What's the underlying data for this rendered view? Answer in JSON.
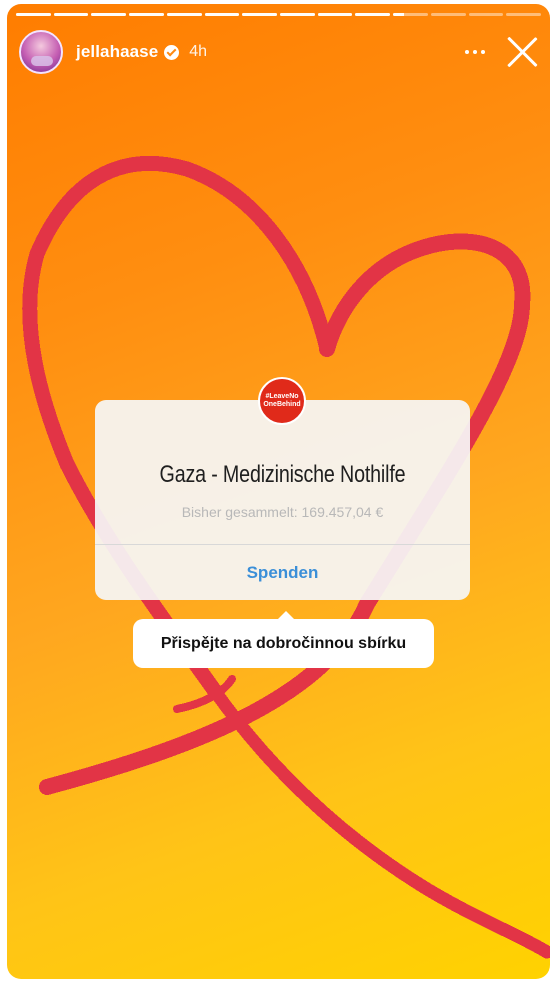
{
  "story": {
    "progress_segments": 14,
    "current_segment": 10,
    "current_segment_progress": 0.3,
    "background_colors": [
      "#ff7d00",
      "#ffd200"
    ],
    "heart_color": "#e23446"
  },
  "header": {
    "username": "jellahaase",
    "time": "4h",
    "avatar_icon": "profile-avatar",
    "verified_icon": "verified-badge-icon",
    "more_icon": "more-options-icon",
    "close_icon": "close-icon"
  },
  "fundraiser": {
    "badge_text": "#LeaveNo\nOneBehind",
    "title": "Gaza - Medizinische Nothilfe",
    "raised": "Bisher gesammelt: 169.457,04 €",
    "button_label": "Spenden",
    "badge_color": "#e02a1a",
    "button_color": "#3b8fd8"
  },
  "tooltip": {
    "text": "Přispějte na dobročinnou sbírku"
  }
}
